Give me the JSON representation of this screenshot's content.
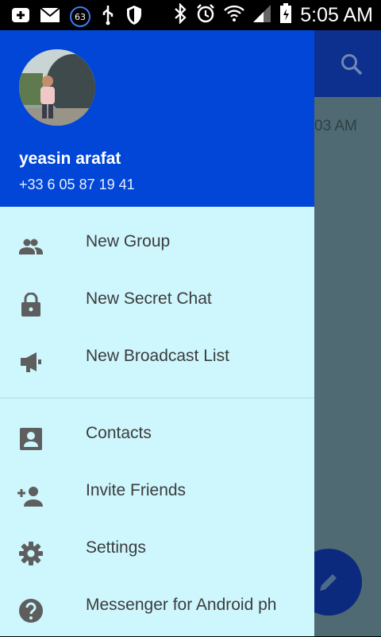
{
  "status_bar": {
    "time": "5:05 AM",
    "notification_count": "63",
    "icons": [
      "add-icon",
      "mail-icon",
      "usb-icon",
      "shield-icon",
      "bluetooth-icon",
      "alarm-icon",
      "wifi-icon",
      "signal-icon",
      "battery-charging-icon"
    ]
  },
  "background": {
    "timestamp": "03 AM",
    "toolbar_color": "#0d2f8e",
    "icons": [
      "search-icon",
      "pencil-icon"
    ]
  },
  "drawer": {
    "header_color": "#0146d7",
    "background_color": "#cdf6fd",
    "user_name": "yeasin arafat",
    "phone": "+33 6 05 87 19 41",
    "items": [
      {
        "label": "New Group",
        "icon": "group-icon"
      },
      {
        "label": "New Secret Chat",
        "icon": "lock-icon"
      },
      {
        "label": "New Broadcast List",
        "icon": "megaphone-icon"
      },
      {
        "label": "Contacts",
        "icon": "contact-card-icon"
      },
      {
        "label": "Invite Friends",
        "icon": "add-person-icon"
      },
      {
        "label": "Settings",
        "icon": "gear-icon"
      },
      {
        "label": "Messenger for Android ph",
        "icon": "help-icon"
      }
    ]
  }
}
